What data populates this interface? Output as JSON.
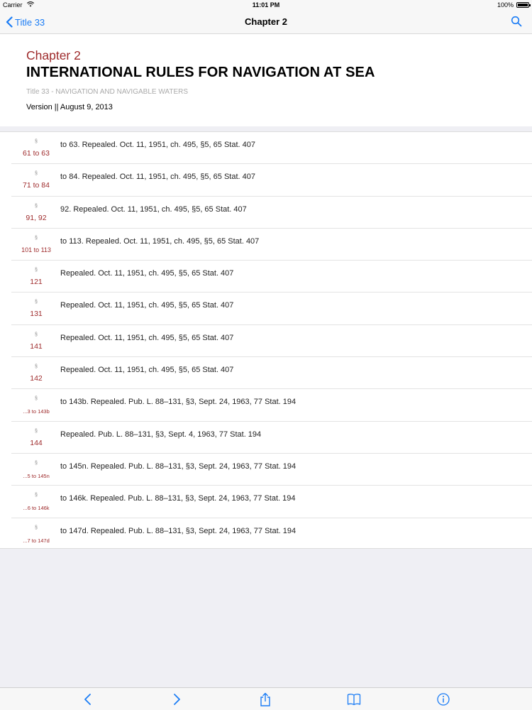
{
  "status_bar": {
    "carrier": "Carrier",
    "time": "11:01 PM",
    "battery": "100%",
    "icons": [
      "wifi-icon",
      "battery-icon"
    ]
  },
  "nav": {
    "back_label": "Title 33",
    "title": "Chapter 2",
    "icons": [
      "chevron-left-icon",
      "search-icon"
    ]
  },
  "header": {
    "chapter": "Chapter 2",
    "title": "INTERNATIONAL RULES FOR NAVIGATION AT SEA",
    "title_ref": "Title 33 - NAVIGATION AND NAVIGABLE WATERS",
    "version": "Version || August 9, 2013"
  },
  "colors": {
    "accent": "#9e2a2b",
    "link": "#1a7cf5",
    "background": "#efeff4"
  },
  "sections": [
    {
      "symbol": "§",
      "number": "61 to 63",
      "text": "to 63. Repealed. Oct. 11, 1951, ch. 495, §5, 65 Stat. 407"
    },
    {
      "symbol": "§",
      "number": "71 to 84",
      "text": "to 84. Repealed. Oct. 11, 1951, ch. 495, §5, 65 Stat. 407"
    },
    {
      "symbol": "§",
      "number": "91, 92",
      "text": "92. Repealed. Oct. 11, 1951, ch. 495, §5, 65 Stat. 407"
    },
    {
      "symbol": "§",
      "number": "101 to 113",
      "text": "to 113. Repealed. Oct. 11, 1951, ch. 495, §5, 65 Stat. 407"
    },
    {
      "symbol": "§",
      "number": "121",
      "text": "Repealed. Oct. 11, 1951, ch. 495, §5, 65 Stat. 407"
    },
    {
      "symbol": "§",
      "number": "131",
      "text": "Repealed. Oct. 11, 1951, ch. 495, §5, 65 Stat. 407"
    },
    {
      "symbol": "§",
      "number": "141",
      "text": "Repealed. Oct. 11, 1951, ch. 495, §5, 65 Stat. 407"
    },
    {
      "symbol": "§",
      "number": "142",
      "text": "Repealed. Oct. 11, 1951, ch. 495, §5, 65 Stat. 407"
    },
    {
      "symbol": "§",
      "number": "...3 to 143b",
      "text": "to 143b. Repealed. Pub. L. 88–131, §3, Sept. 24, 1963, 77 Stat. 194"
    },
    {
      "symbol": "§",
      "number": "144",
      "text": "Repealed. Pub. L. 88–131, §3, Sept. 4, 1963, 77 Stat. 194"
    },
    {
      "symbol": "§",
      "number": "...5 to 145n",
      "text": "to 145n. Repealed. Pub. L. 88–131, §3, Sept. 24, 1963, 77 Stat. 194"
    },
    {
      "symbol": "§",
      "number": "...6 to 146k",
      "text": "to 146k. Repealed. Pub. L. 88–131, §3, Sept. 24, 1963, 77 Stat. 194"
    },
    {
      "symbol": "§",
      "number": "...7 to 147d",
      "text": "to 147d. Repealed. Pub. L. 88–131, §3, Sept. 24, 1963, 77 Stat. 194"
    }
  ],
  "toolbar": {
    "icons": [
      "chevron-left-icon",
      "chevron-right-icon",
      "share-icon",
      "book-icon",
      "info-icon"
    ]
  }
}
